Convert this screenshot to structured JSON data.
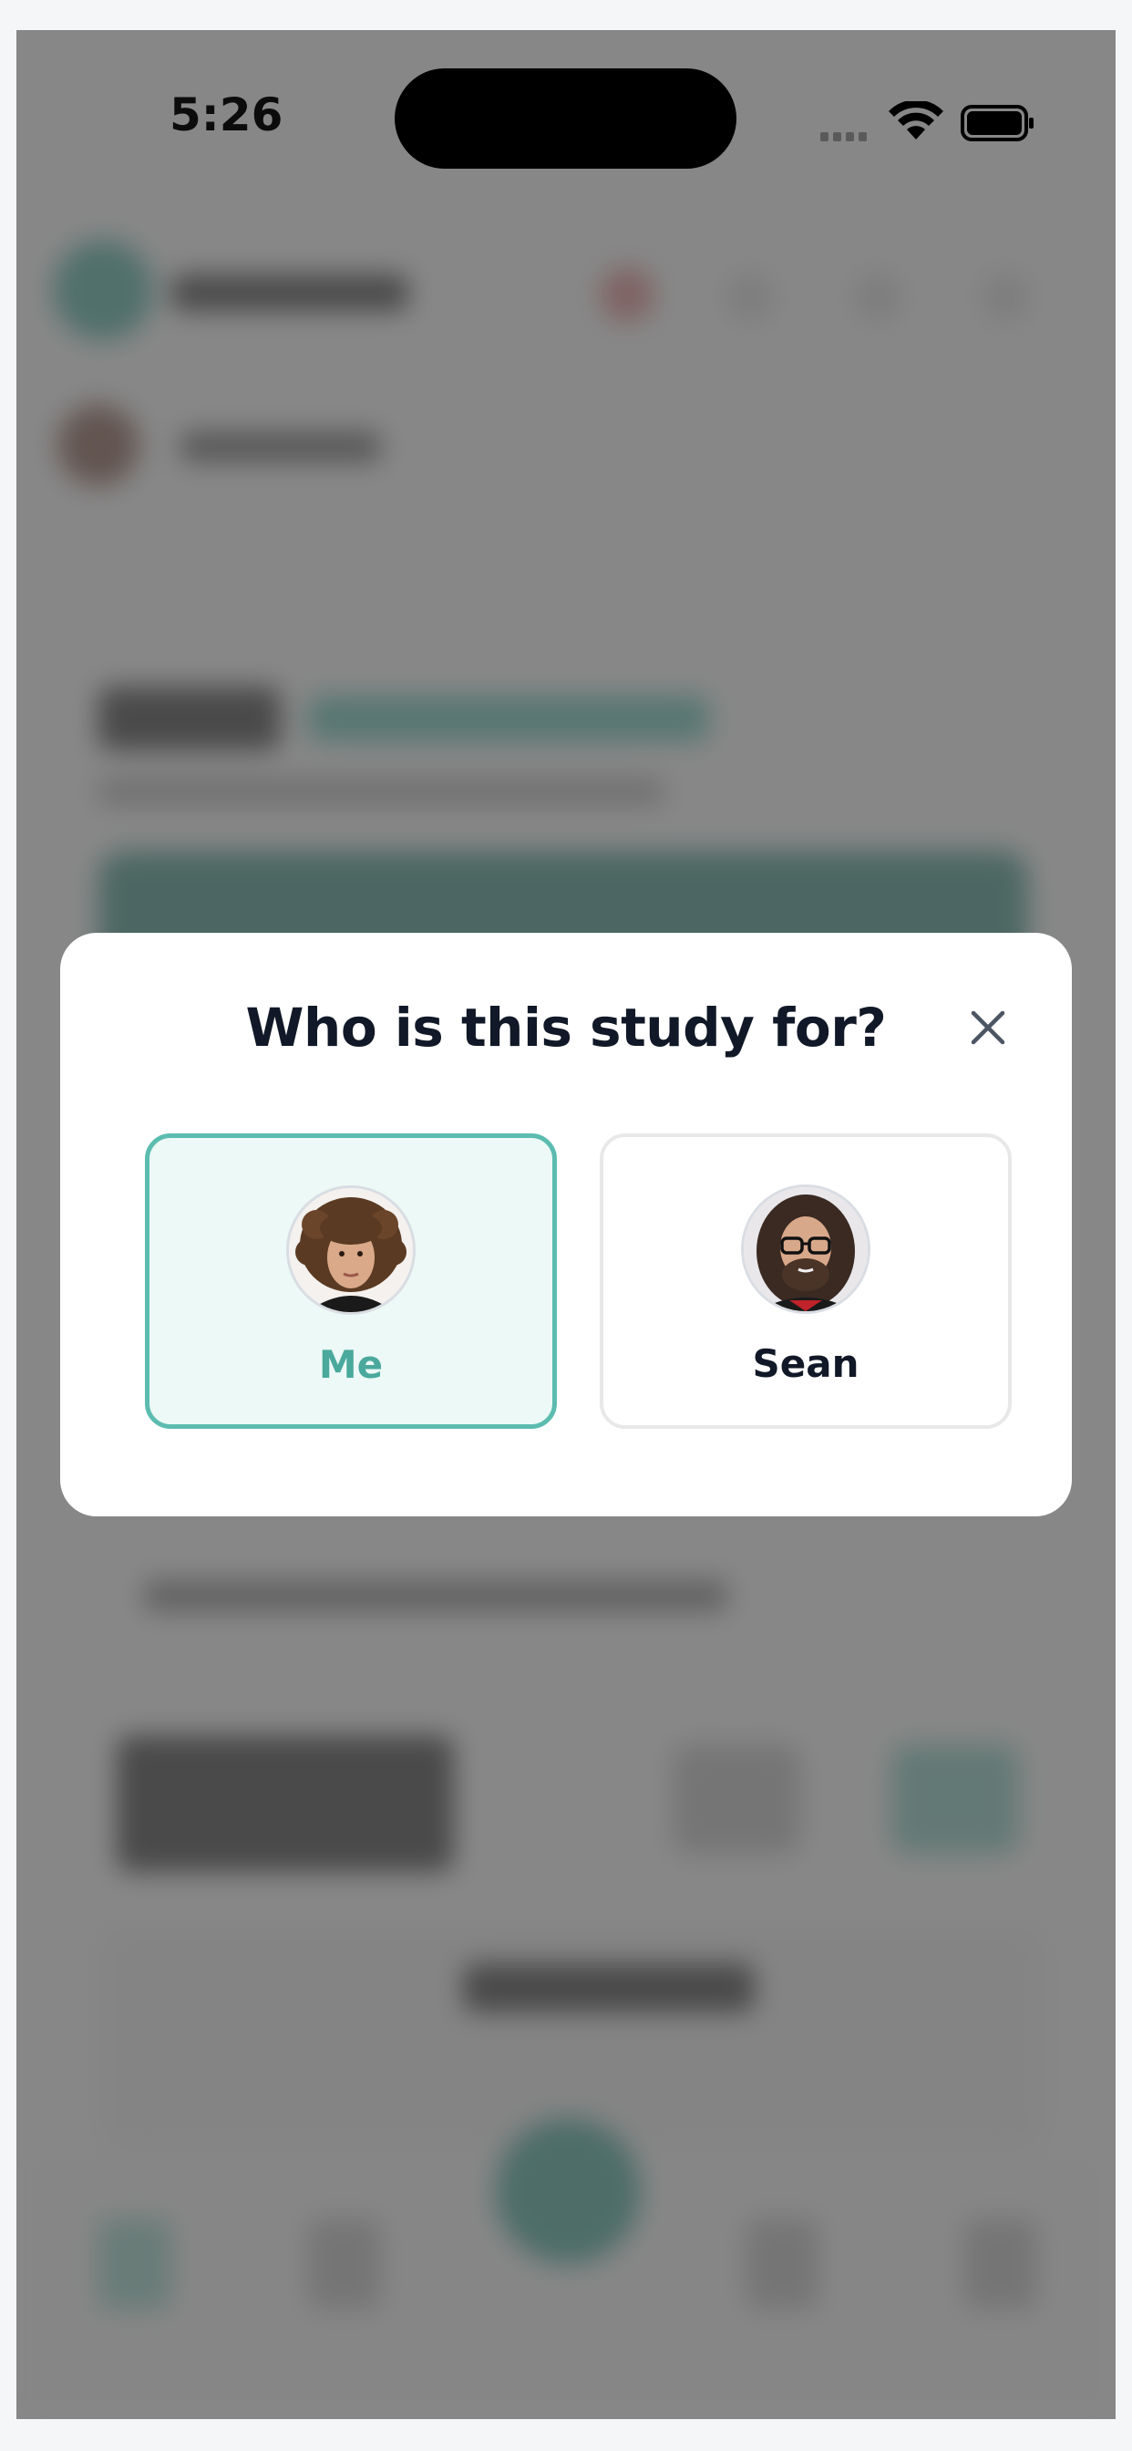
{
  "status_bar": {
    "time": "5:26"
  },
  "modal": {
    "title": "Who is this study for?",
    "options": [
      {
        "label": "Me",
        "selected": true
      },
      {
        "label": "Sean",
        "selected": false
      }
    ]
  },
  "colors": {
    "accent": "#5bbcaf",
    "accent_text": "#4aa99c",
    "selected_bg": "#ecf9f6",
    "title": "#111827",
    "overlay": "#7a7a7a"
  },
  "icons": {
    "close": "close-icon",
    "wifi": "wifi-icon",
    "battery": "battery-icon",
    "signal": "cellular-signal-icon"
  }
}
